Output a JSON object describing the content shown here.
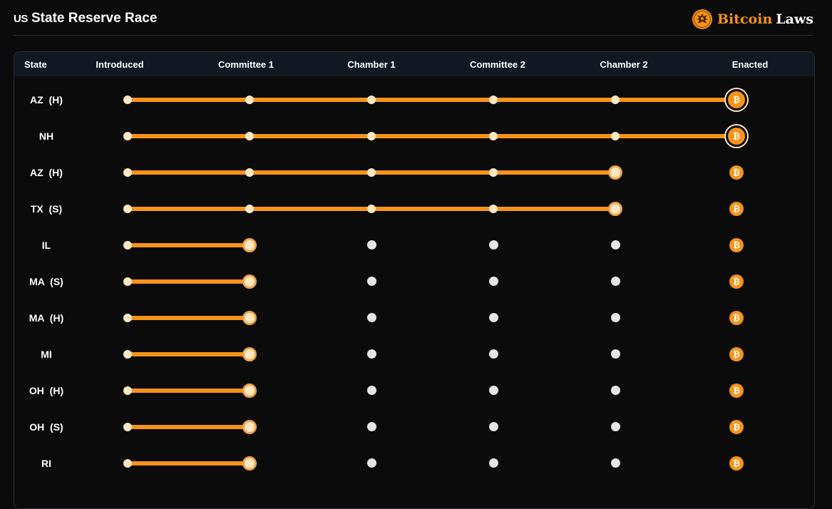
{
  "header": {
    "flag": "US",
    "title": "State Reserve Race",
    "brand_bitcoin": "Bitcoin",
    "brand_laws": "Laws"
  },
  "columns": [
    "State",
    "Introduced",
    "Committee 1",
    "Chamber 1",
    "Committee 2",
    "Chamber 2",
    "Enacted"
  ],
  "stage_count": 5,
  "rows": [
    {
      "state": "AZ  (H)",
      "progress": 5
    },
    {
      "state": "NH",
      "progress": 5
    },
    {
      "state": "AZ  (H)",
      "progress": 4
    },
    {
      "state": "TX  (S)",
      "progress": 4
    },
    {
      "state": "IL",
      "progress": 1
    },
    {
      "state": "MA  (S)",
      "progress": 1
    },
    {
      "state": "MA  (H)",
      "progress": 1
    },
    {
      "state": "MI",
      "progress": 1
    },
    {
      "state": "OH  (H)",
      "progress": 1
    },
    {
      "state": "OH  (S)",
      "progress": 1
    },
    {
      "state": "RI",
      "progress": 1
    }
  ],
  "icons": {
    "coin": "bitcoin-icon",
    "logo": "eagle-seal-icon"
  },
  "colors": {
    "accent": "#f7931a",
    "background": "#0b0b0b",
    "header_bg": "#121821"
  },
  "coin_symbol": "₿"
}
